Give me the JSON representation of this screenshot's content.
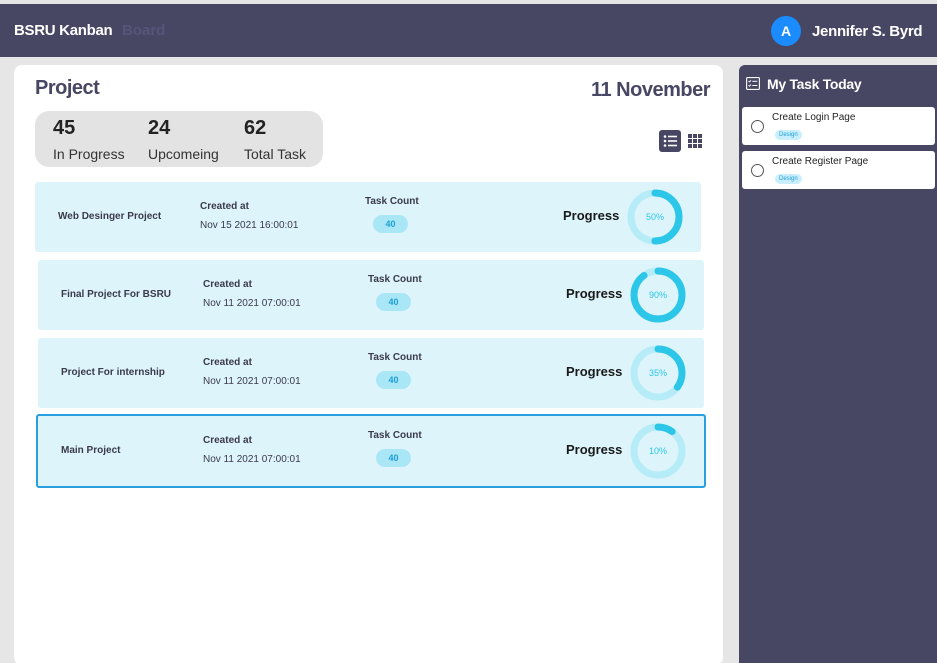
{
  "header": {
    "brand": "BSRU Kanban",
    "nav_ghost": "Board",
    "avatar_letter": "A",
    "user_name": "Jennifer S. Byrd"
  },
  "main": {
    "title": "Project",
    "date": "11 November",
    "stats": [
      {
        "value": "45",
        "label": "In Progress"
      },
      {
        "value": "24",
        "label": "Upcomeing"
      },
      {
        "value": "62",
        "label": "Total Task"
      }
    ],
    "view_toggle": {
      "list_icon": "list-icon",
      "grid_icon": "grid-icon"
    },
    "projects": [
      {
        "name": "Web Desinger Project",
        "created_label": "Created at",
        "created_at": "Nov 15 2021 16:00:01",
        "task_count_label": "Task Count",
        "task_count": "40",
        "progress_label": "Progress",
        "progress": 50,
        "progress_text": "50%",
        "selected": false
      },
      {
        "name": "Final Project For BSRU",
        "created_label": "Created at",
        "created_at": "Nov 11 2021 07:00:01",
        "task_count_label": "Task Count",
        "task_count": "40",
        "progress_label": "Progress",
        "progress": 90,
        "progress_text": "90%",
        "selected": false
      },
      {
        "name": "Project For internship",
        "created_label": "Created at",
        "created_at": "Nov 11 2021 07:00:01",
        "task_count_label": "Task Count",
        "task_count": "40",
        "progress_label": "Progress",
        "progress": 35,
        "progress_text": "35%",
        "selected": false
      },
      {
        "name": "Main Project",
        "created_label": "Created at",
        "created_at": "Nov 11 2021 07:00:01",
        "task_count_label": "Task Count",
        "task_count": "40",
        "progress_label": "Progress",
        "progress": 10,
        "progress_text": "10%",
        "selected": true
      }
    ]
  },
  "sidebar": {
    "icon": "checklist-icon",
    "title": "My Task Today",
    "tasks": [
      {
        "title": "Create Login Page",
        "tag": "Design"
      },
      {
        "title": "Create Register Page",
        "tag": "Design"
      }
    ]
  },
  "colors": {
    "header_bg": "#474764",
    "card_bg": "#ddf4fb",
    "accent": "#2bc6e8",
    "selected_border": "#2a9fe0",
    "avatar": "#1a8cff"
  }
}
